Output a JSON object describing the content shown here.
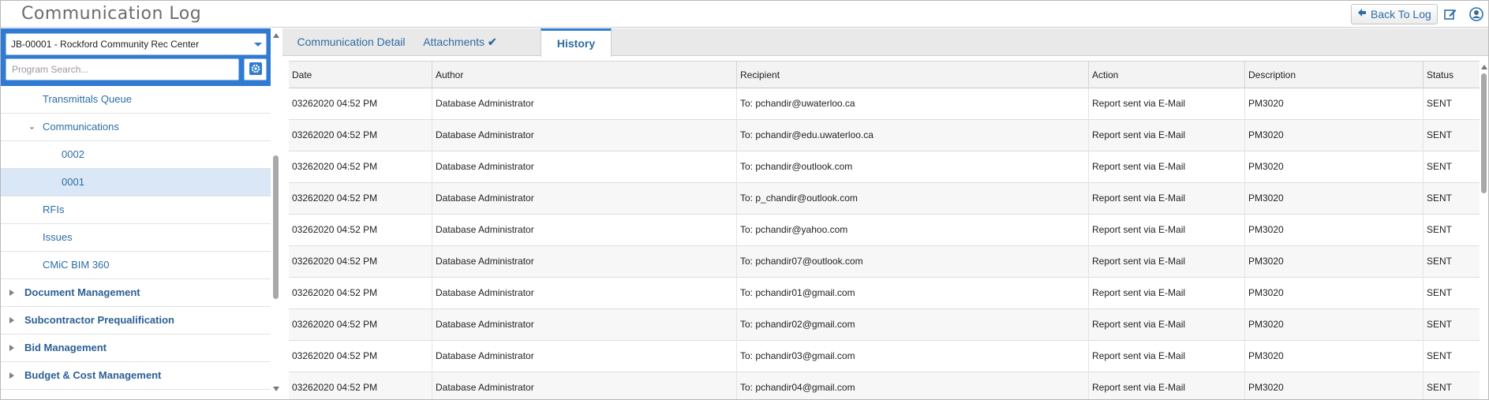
{
  "app": {
    "title": "Communication Log"
  },
  "header": {
    "back_label": "Back To Log"
  },
  "sidebar": {
    "job": "JB-00001 - Rockford Community Rec Center",
    "search_placeholder": "Program Search...",
    "items": [
      {
        "label": "Transmittals Queue"
      },
      {
        "label": "Communications"
      },
      {
        "label": "0002"
      },
      {
        "label": "0001"
      },
      {
        "label": "RFIs"
      },
      {
        "label": "Issues"
      },
      {
        "label": "CMiC BIM 360"
      },
      {
        "label": "Document Management"
      },
      {
        "label": "Subcontractor Prequalification"
      },
      {
        "label": "Bid Management"
      },
      {
        "label": "Budget & Cost Management"
      }
    ]
  },
  "tabs": [
    {
      "label": "Communication Detail"
    },
    {
      "label": "Attachments"
    },
    {
      "label": "History"
    }
  ],
  "grid": {
    "columns": [
      "Date",
      "Author",
      "Recipient",
      "Action",
      "Description",
      "Status"
    ],
    "rows": [
      [
        "03262020 04:52 PM",
        "Database Administrator",
        "To: pchandir@uwaterloo.ca",
        "Report sent via E-Mail",
        "PM3020",
        "SENT"
      ],
      [
        "03262020 04:52 PM",
        "Database Administrator",
        "To: pchandir@edu.uwaterloo.ca",
        "Report sent via E-Mail",
        "PM3020",
        "SENT"
      ],
      [
        "03262020 04:52 PM",
        "Database Administrator",
        "To: pchandir@outlook.com",
        "Report sent via E-Mail",
        "PM3020",
        "SENT"
      ],
      [
        "03262020 04:52 PM",
        "Database Administrator",
        "To: p_chandir@outlook.com",
        "Report sent via E-Mail",
        "PM3020",
        "SENT"
      ],
      [
        "03262020 04:52 PM",
        "Database Administrator",
        "To: pchandir@yahoo.com",
        "Report sent via E-Mail",
        "PM3020",
        "SENT"
      ],
      [
        "03262020 04:52 PM",
        "Database Administrator",
        "To: pchandir07@outlook.com",
        "Report sent via E-Mail",
        "PM3020",
        "SENT"
      ],
      [
        "03262020 04:52 PM",
        "Database Administrator",
        "To: pchandir01@gmail.com",
        "Report sent via E-Mail",
        "PM3020",
        "SENT"
      ],
      [
        "03262020 04:52 PM",
        "Database Administrator",
        "To: pchandir02@gmail.com",
        "Report sent via E-Mail",
        "PM3020",
        "SENT"
      ],
      [
        "03262020 04:52 PM",
        "Database Administrator",
        "To: pchandir03@gmail.com",
        "Report sent via E-Mail",
        "PM3020",
        "SENT"
      ],
      [
        "03262020 04:52 PM",
        "Database Administrator",
        "To: pchandir04@gmail.com",
        "Report sent via E-Mail",
        "PM3020",
        "SENT"
      ]
    ]
  },
  "colors": {
    "accent": "#2f7bd3",
    "link": "#2e6da4",
    "selected_row": "#d9e7f6"
  },
  "icons": [
    "back-arrow-icon",
    "edit-icon",
    "user-icon",
    "gear-icon",
    "check-icon",
    "chevron-down-icon"
  ]
}
